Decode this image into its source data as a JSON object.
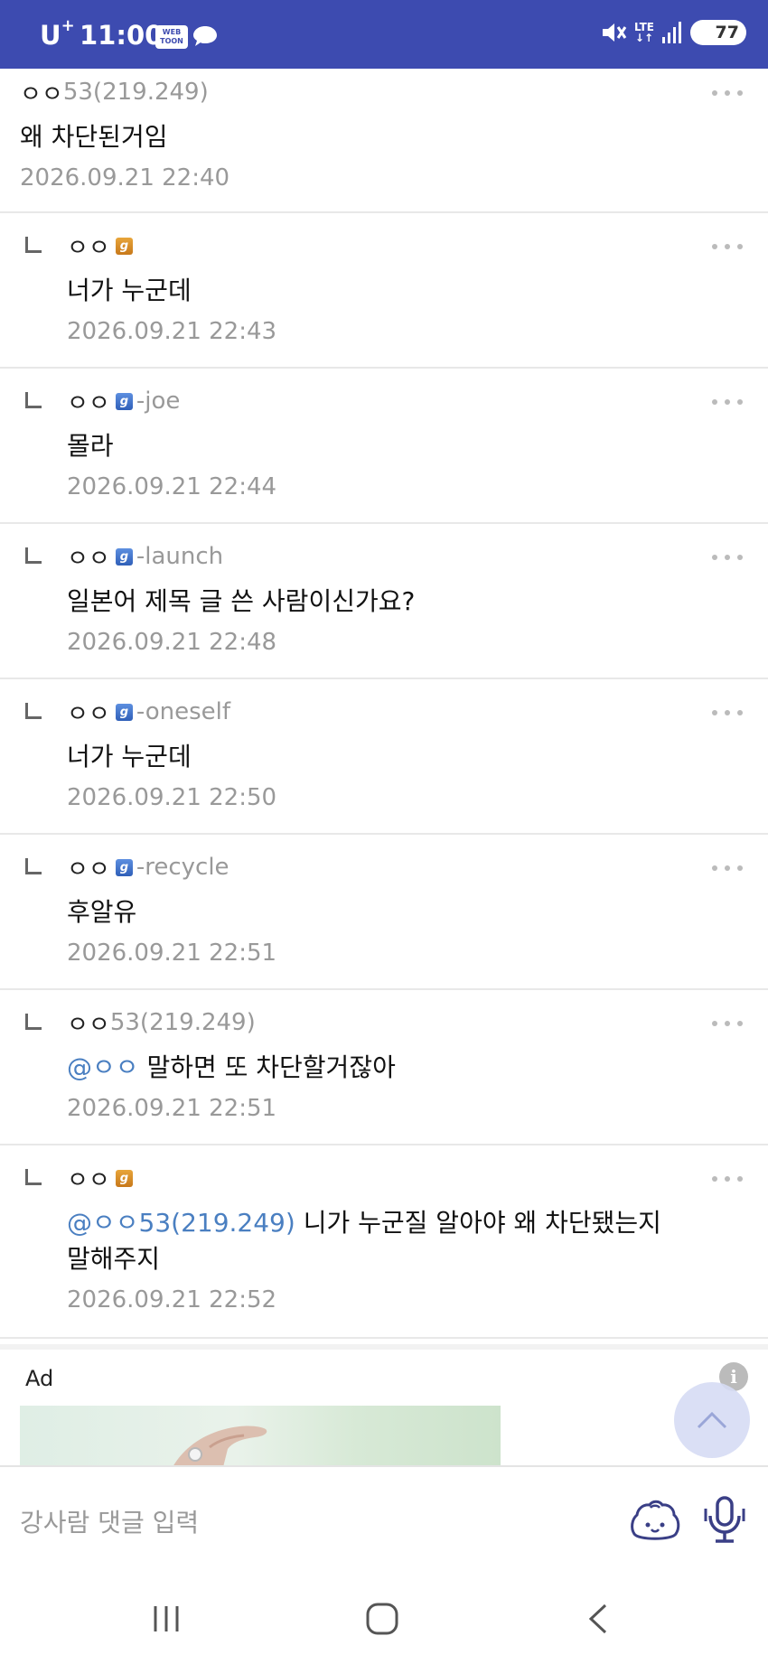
{
  "status_bar": {
    "carrier": "U",
    "carrier_sup": "+",
    "time": "11:00",
    "webtoon_icon_text": "WEB TOON",
    "lte": "LTE",
    "battery": "77"
  },
  "comments": [
    {
      "nick": "ㅇㅇ",
      "ip": "53(219.249)",
      "badge": "",
      "ext": "",
      "mention": "",
      "text": "왜 차단된거임",
      "date": "2026.09.21 22:40",
      "reply": false
    },
    {
      "nick": "ㅇㅇ",
      "ip": "",
      "badge": "gold",
      "ext": "",
      "mention": "",
      "text": "너가 누군데",
      "date": "2026.09.21 22:43",
      "reply": true
    },
    {
      "nick": "ㅇㅇ",
      "ip": "",
      "badge": "blue",
      "ext": "-joe",
      "mention": "",
      "text": "몰라",
      "date": "2026.09.21 22:44",
      "reply": true
    },
    {
      "nick": "ㅇㅇ",
      "ip": "",
      "badge": "blue",
      "ext": "-launch",
      "mention": "",
      "text": "일본어 제목 글 쓴 사람이신가요?",
      "date": "2026.09.21 22:48",
      "reply": true
    },
    {
      "nick": "ㅇㅇ",
      "ip": "",
      "badge": "blue",
      "ext": "-oneself",
      "mention": "",
      "text": "너가 누군데",
      "date": "2026.09.21 22:50",
      "reply": true
    },
    {
      "nick": "ㅇㅇ",
      "ip": "",
      "badge": "blue",
      "ext": "-recycle",
      "mention": "",
      "text": "후알유",
      "date": "2026.09.21 22:51",
      "reply": true
    },
    {
      "nick": "ㅇㅇ",
      "ip": "53(219.249)",
      "badge": "",
      "ext": "",
      "mention": "@ㅇㅇ",
      "text": "말하면 또 차단할거잖아",
      "date": "2026.09.21 22:51",
      "reply": true
    },
    {
      "nick": "ㅇㅇ",
      "ip": "",
      "badge": "gold",
      "ext": "",
      "mention": "@ㅇㅇ53(219.249)",
      "text": "니가 누군질 알아야 왜 차단됐는지 말해주지",
      "date": "2026.09.21 22:52",
      "reply": true
    }
  ],
  "ad": {
    "label": "Ad",
    "info_icon": "i"
  },
  "input": {
    "placeholder": "강사람 댓글 입력"
  },
  "icons": {
    "more": "more-dots-icon",
    "reply": "reply-arrow-icon",
    "scroll_top": "chevron-up-icon",
    "emoji": "emoji-face-icon",
    "mic": "microphone-icon",
    "nav_recent": "recent-apps-icon",
    "nav_home": "home-icon",
    "nav_back": "back-icon"
  }
}
